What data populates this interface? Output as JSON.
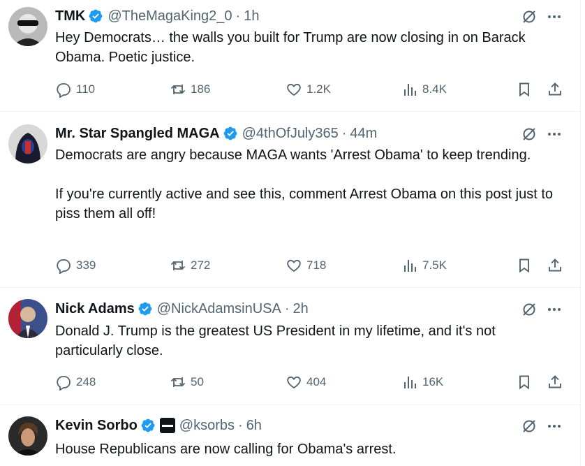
{
  "tweets": [
    {
      "name": "TMK",
      "handle": "@TheMagaKing2_0",
      "time": "1h",
      "text": [
        "Hey Democrats… the walls you built for Trump are now closing in on Barack Obama. Poetic justice."
      ],
      "replies": "110",
      "reposts": "186",
      "likes": "1.2K",
      "views": "8.4K"
    },
    {
      "name": "Mr. Star Spangled MAGA",
      "handle": "@4thOfJuly365",
      "time": "44m",
      "text": [
        "Democrats are angry because MAGA wants 'Arrest Obama' to keep trending.",
        "If you're currently active and see this, comment Arrest Obama on this post just to piss them all off!"
      ],
      "replies": "339",
      "reposts": "272",
      "likes": "718",
      "views": "7.5K"
    },
    {
      "name": "Nick Adams",
      "handle": "@NickAdamsinUSA",
      "time": "2h",
      "text": [
        "Donald J. Trump is the greatest US President in my lifetime, and it's not particularly close."
      ],
      "replies": "248",
      "reposts": "50",
      "likes": "404",
      "views": "16K"
    },
    {
      "name": "Kevin Sorbo",
      "handle": "@ksorbs",
      "time": "6h",
      "text": [
        "House Republicans are now calling for Obama's arrest."
      ]
    }
  ],
  "separator": "·",
  "icons": {
    "verified": "verified-badge-icon",
    "affiliate": "affiliate-badge-icon",
    "grok": "grok-icon",
    "more": "more-options-icon",
    "reply": "reply-icon",
    "repost": "repost-icon",
    "like": "like-icon",
    "views": "views-icon",
    "bookmark": "bookmark-icon",
    "share": "share-icon"
  },
  "colors": {
    "text": "#0f1419",
    "secondary": "#536471",
    "verified": "#1d9bf0",
    "divider": "#eff3f4"
  }
}
